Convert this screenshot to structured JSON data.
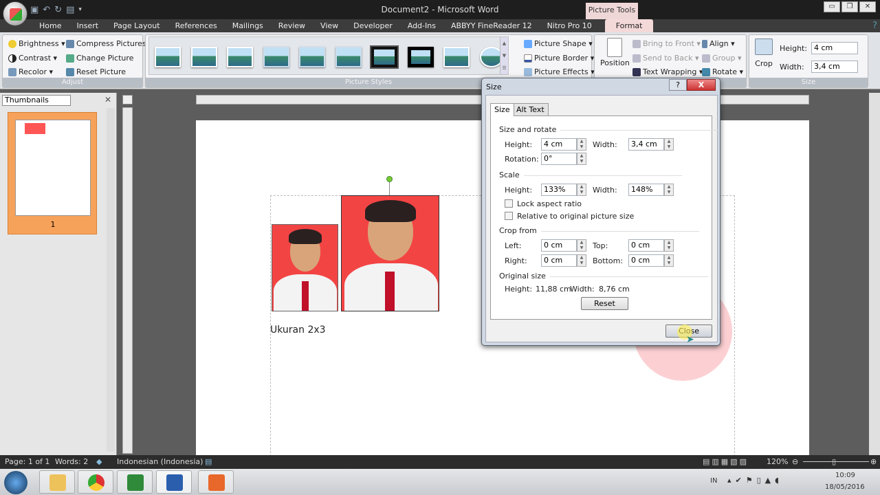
{
  "window": {
    "title": "Document2 - Microsoft Word",
    "context_tab_group": "Picture Tools"
  },
  "tabs": [
    "Home",
    "Insert",
    "Page Layout",
    "References",
    "Mailings",
    "Review",
    "View",
    "Developer",
    "Add-Ins",
    "ABBYY FineReader 12",
    "Nitro Pro 10",
    "Format"
  ],
  "active_tab": "Format",
  "ribbon": {
    "adjust": {
      "label": "Adjust",
      "brightness": "Brightness ▾",
      "contrast": "Contrast ▾",
      "recolor": "Recolor ▾",
      "compress": "Compress Pictures",
      "change": "Change Picture",
      "reset": "Reset Picture"
    },
    "styles": {
      "label": "Picture Styles",
      "shape": "Picture Shape ▾",
      "border": "Picture Border ▾",
      "effects": "Picture Effects ▾"
    },
    "arrange": {
      "position": "Position",
      "bring_front": "Bring to Front ▾",
      "send_back": "Send to Back ▾",
      "text_wrapping": "Text Wrapping ▾",
      "align": "Align ▾",
      "group": "Group ▾",
      "rotate": "Rotate ▾"
    },
    "size": {
      "label": "Size",
      "crop": "Crop",
      "height_label": "Height:",
      "height_value": "4 cm",
      "width_label": "Width:",
      "width_value": "3,4 cm"
    }
  },
  "left_pane": {
    "selector": "Thumbnails",
    "page_number": "1"
  },
  "document": {
    "caption": "Ukuran 2x3"
  },
  "dialog": {
    "title": "Size",
    "help": "?",
    "close_x": "X",
    "tabs": [
      "Size",
      "Alt Text"
    ],
    "size_rotate": {
      "header": "Size and rotate",
      "height_label": "Height:",
      "height": "4 cm",
      "width_label": "Width:",
      "width": "3,4 cm",
      "rotation_label": "Rotation:",
      "rotation": "0°"
    },
    "scale": {
      "header": "Scale",
      "height_label": "Height:",
      "height": "133%",
      "width_label": "Width:",
      "width": "148%",
      "lock_aspect": "Lock aspect ratio",
      "lock_aspect_checked": false,
      "relative": "Relative to original picture size",
      "relative_checked": false
    },
    "crop": {
      "header": "Crop from",
      "left_label": "Left:",
      "left": "0 cm",
      "top_label": "Top:",
      "top": "0 cm",
      "right_label": "Right:",
      "right": "0 cm",
      "bottom_label": "Bottom:",
      "bottom": "0 cm"
    },
    "original": {
      "header": "Original size",
      "height_label": "Height:",
      "height": "11,88 cm",
      "width_label": "Width:",
      "width": "8,76 cm"
    },
    "reset": "Reset",
    "close": "Close"
  },
  "statusbar": {
    "page": "Page: 1 of 1",
    "words": "Words: 2",
    "language": "Indonesian (Indonesia)",
    "zoom": "120%"
  },
  "taskbar": {
    "apps": [
      "windows-explorer",
      "chrome",
      "excel",
      "word",
      "app-orange"
    ],
    "lang": "IN",
    "time": "10:09",
    "date": "18/05/2016"
  }
}
